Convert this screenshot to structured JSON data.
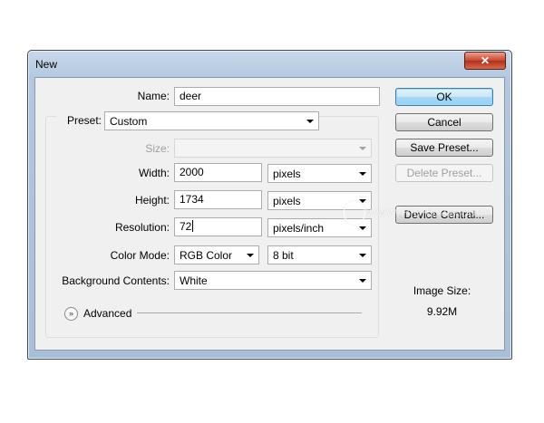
{
  "window": {
    "title": "New",
    "close_glyph": "✕"
  },
  "fields": {
    "name_label": "Name:",
    "name_value": "deer",
    "preset_label": "Preset:",
    "preset_value": "Custom",
    "size_label": "Size:",
    "size_value": "",
    "width_label": "Width:",
    "width_value": "2000",
    "width_unit": "pixels",
    "height_label": "Height:",
    "height_value": "1734",
    "height_unit": "pixels",
    "resolution_label": "Resolution:",
    "resolution_value": "72",
    "resolution_unit": "pixels/inch",
    "color_mode_label": "Color Mode:",
    "color_mode_value": "RGB Color",
    "bit_depth_value": "8 bit",
    "background_label": "Background Contents:",
    "background_value": "White",
    "advanced_label": "Advanced"
  },
  "buttons": {
    "ok": "OK",
    "cancel": "Cancel",
    "save_preset": "Save Preset...",
    "delete_preset": "Delete Preset...",
    "device_central": "Device Central..."
  },
  "image_size": {
    "label": "Image Size:",
    "value": "9.92M"
  },
  "watermark": {
    "text": "www.Pic-Bmw.com",
    "icon": "camera-logo-icon"
  },
  "colors": {
    "default_button": "#a6d7f4",
    "close_button": "#c8452c",
    "title_bar": "#b3c8e0"
  }
}
